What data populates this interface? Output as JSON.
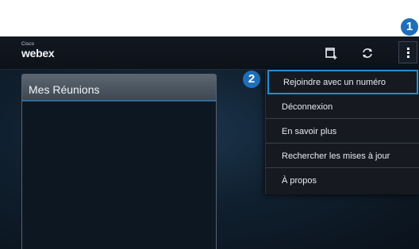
{
  "app": {
    "logo_small": "Cisco",
    "logo_main": "webex"
  },
  "actionbar": {
    "icons": [
      "new-meeting-icon",
      "refresh-icon",
      "overflow-menu-icon"
    ]
  },
  "callouts": {
    "first": "1",
    "second": "2"
  },
  "meetings_panel": {
    "title": "Mes Réunions"
  },
  "overflow_menu": {
    "items": [
      {
        "label": "Rejoindre avec un numéro",
        "highlighted": true
      },
      {
        "label": "Déconnexion"
      },
      {
        "label": "En savoir plus"
      },
      {
        "label": "Rechercher les mises à jour"
      },
      {
        "label": "À propos"
      }
    ]
  },
  "colors": {
    "accent": "#1e8fd6",
    "callout": "#1e6fb8"
  }
}
